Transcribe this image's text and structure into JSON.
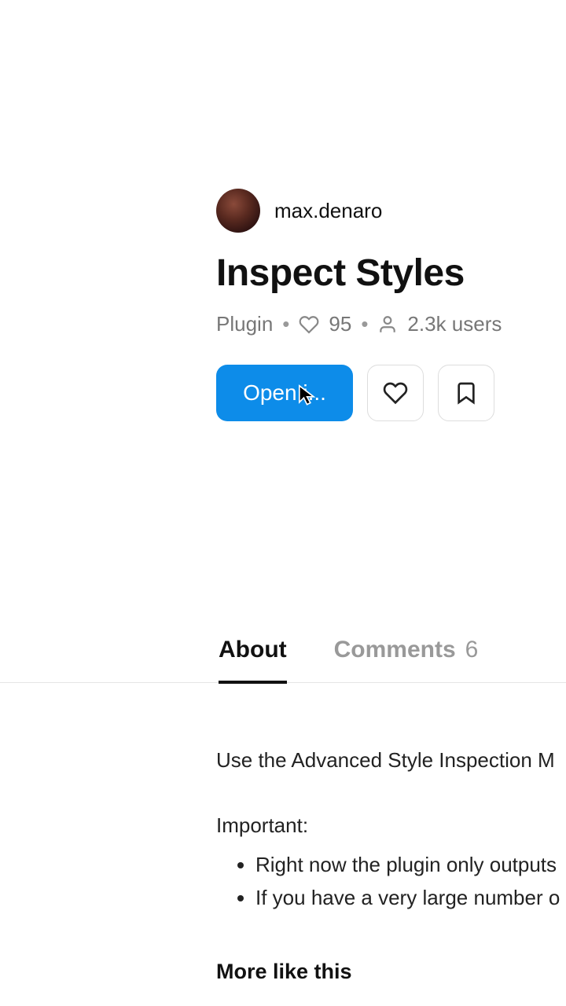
{
  "author": {
    "name": "max.denaro"
  },
  "title": "Inspect Styles",
  "meta": {
    "type": "Plugin",
    "likes": "95",
    "users": "2.3k users"
  },
  "actions": {
    "open_label": "Open i..."
  },
  "tabs": {
    "about": "About",
    "comments": "Comments",
    "comments_count": "6"
  },
  "description": {
    "intro": "Use the Advanced Style Inspection M",
    "important_label": "Important:",
    "bullets": [
      "Right now the plugin only outputs",
      "If you have a very large number o"
    ]
  },
  "more_heading": "More like this"
}
